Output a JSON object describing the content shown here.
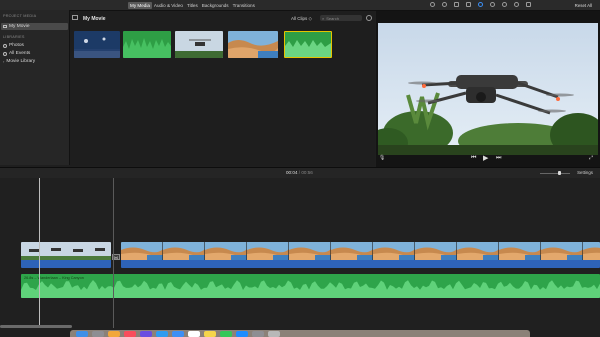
{
  "toolbar": {
    "tabs": [
      "My Media",
      "Audio & Video",
      "Titles",
      "Backgrounds",
      "Transitions"
    ],
    "active_tab": "My Media",
    "reset_all": "Reset All"
  },
  "sidebar": {
    "project_media_header": "PROJECT MEDIA",
    "project_item": "My Movie",
    "libraries_header": "LIBRARIES",
    "items": [
      "Photos",
      "All Events",
      "Movie Library"
    ]
  },
  "browser": {
    "title": "My Movie",
    "filter": "All Clips ◇",
    "search_placeholder": "Search",
    "thumbnails": [
      {
        "kind": "video",
        "subject": "drone"
      },
      {
        "kind": "audio",
        "subject": "music"
      },
      {
        "kind": "video",
        "subject": "drone"
      },
      {
        "kind": "video",
        "subject": "canyon"
      },
      {
        "kind": "audio",
        "subject": "music-selected"
      }
    ]
  },
  "viewer": {
    "controls": [
      "microphone-icon",
      "skip-back-icon",
      "play-icon",
      "skip-forward-icon",
      "fullscreen-icon"
    ]
  },
  "timeline": {
    "current_time": "00:04",
    "separator": " / ",
    "duration": "00:56",
    "settings_label": "Settings",
    "audio_clip_label": "26.8s – Wanderlaan – King Canyon",
    "colors": {
      "video_track": "#2e63b8",
      "audio_track": "#2ea44a",
      "audio_wave": "#5fd27a"
    }
  },
  "dock": {
    "apps": [
      "finder-icon",
      "launchpad-icon",
      "photos-icon",
      "music-icon",
      "imovie-icon",
      "safari-icon",
      "mail-icon",
      "calendar-icon",
      "notes-icon",
      "messages-icon",
      "appstore-icon",
      "settings-icon",
      "trash-icon"
    ]
  }
}
